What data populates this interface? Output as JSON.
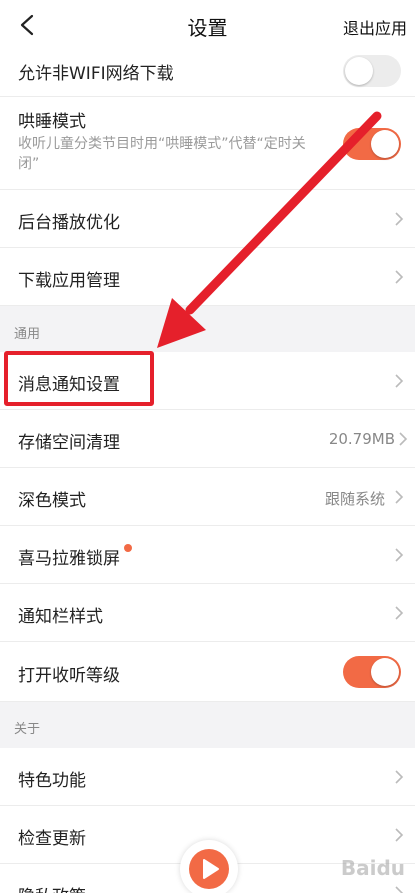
{
  "header": {
    "title": "设置",
    "exit_label": "退出应用"
  },
  "rows": {
    "wifi_download": {
      "label": "允许非WIFI网络下载",
      "enabled": false
    },
    "sleep_mode": {
      "label": "哄睡模式",
      "description": "收听儿童分类节目时用“哄睡模式”代替“定时关闭”",
      "enabled": true
    },
    "background_play": {
      "label": "后台播放优化"
    },
    "download_manage": {
      "label": "下载应用管理"
    },
    "message_notify": {
      "label": "消息通知设置"
    },
    "storage_clean": {
      "label": "存储空间清理",
      "value": "20.79MB"
    },
    "dark_mode": {
      "label": "深色模式",
      "value": "跟随系统"
    },
    "lock_screen": {
      "label": "喜马拉雅锁屏",
      "has_badge": true
    },
    "notify_bar": {
      "label": "通知栏样式"
    },
    "listen_level": {
      "label": "打开收听等级",
      "enabled": true
    },
    "features": {
      "label": "特色功能"
    },
    "check_update": {
      "label": "检查更新"
    },
    "privacy": {
      "label": "隐私政策"
    }
  },
  "sections": {
    "general": "通用",
    "about": "关于"
  },
  "watermark": "Baidu",
  "colors": {
    "accent": "#f26a45",
    "annotation": "#e5202b",
    "section_bg": "#f3f3f5"
  }
}
